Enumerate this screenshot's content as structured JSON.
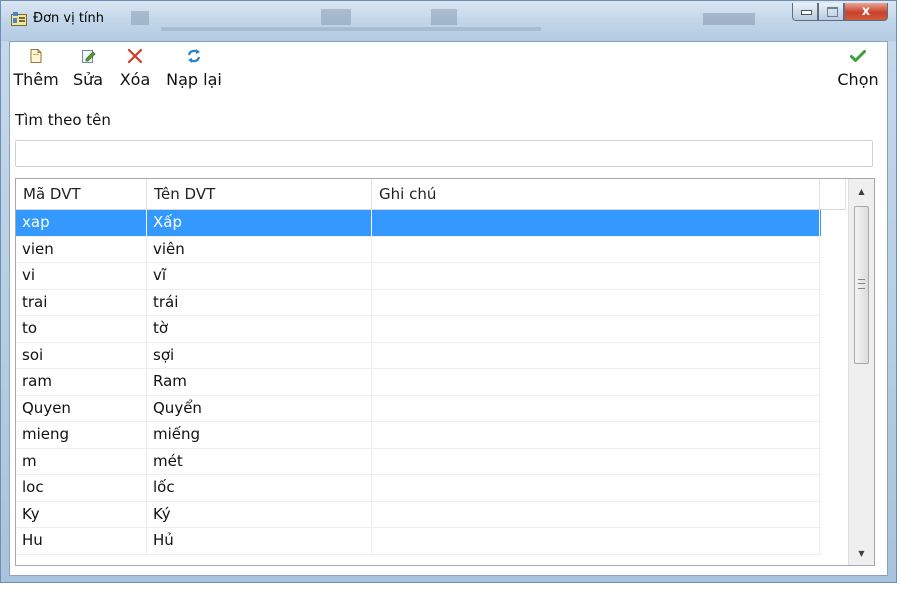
{
  "window": {
    "title": "Đơn vị tính",
    "close_label": "x"
  },
  "toolbar": {
    "add_label": "Thêm",
    "edit_label": "Sửa",
    "delete_label": "Xóa",
    "reload_label": "Nạp lại",
    "select_label": "Chọn"
  },
  "search": {
    "label": "Tìm theo tên",
    "value": ""
  },
  "table": {
    "columns": [
      "Mã DVT",
      "Tên DVT",
      "Ghi chú"
    ],
    "rows": [
      [
        "xap",
        "Xấp",
        ""
      ],
      [
        "vien",
        "viên",
        ""
      ],
      [
        "vi",
        "vĩ",
        ""
      ],
      [
        "trai",
        "trái",
        ""
      ],
      [
        "to",
        "tờ",
        ""
      ],
      [
        "soi",
        "sợi",
        ""
      ],
      [
        "ram",
        "Ram",
        ""
      ],
      [
        "Quyen",
        "Quyển",
        ""
      ],
      [
        "mieng",
        "miếng",
        ""
      ],
      [
        "m",
        "mét",
        ""
      ],
      [
        "loc",
        "lốc",
        ""
      ],
      [
        "Ky",
        "Ký",
        ""
      ],
      [
        "Hu",
        "Hủ",
        ""
      ]
    ],
    "selected_row": 0
  },
  "colors": {
    "selection": "#3399ff",
    "delete_icon": "#d9352c",
    "select_check": "#3aa13a"
  }
}
